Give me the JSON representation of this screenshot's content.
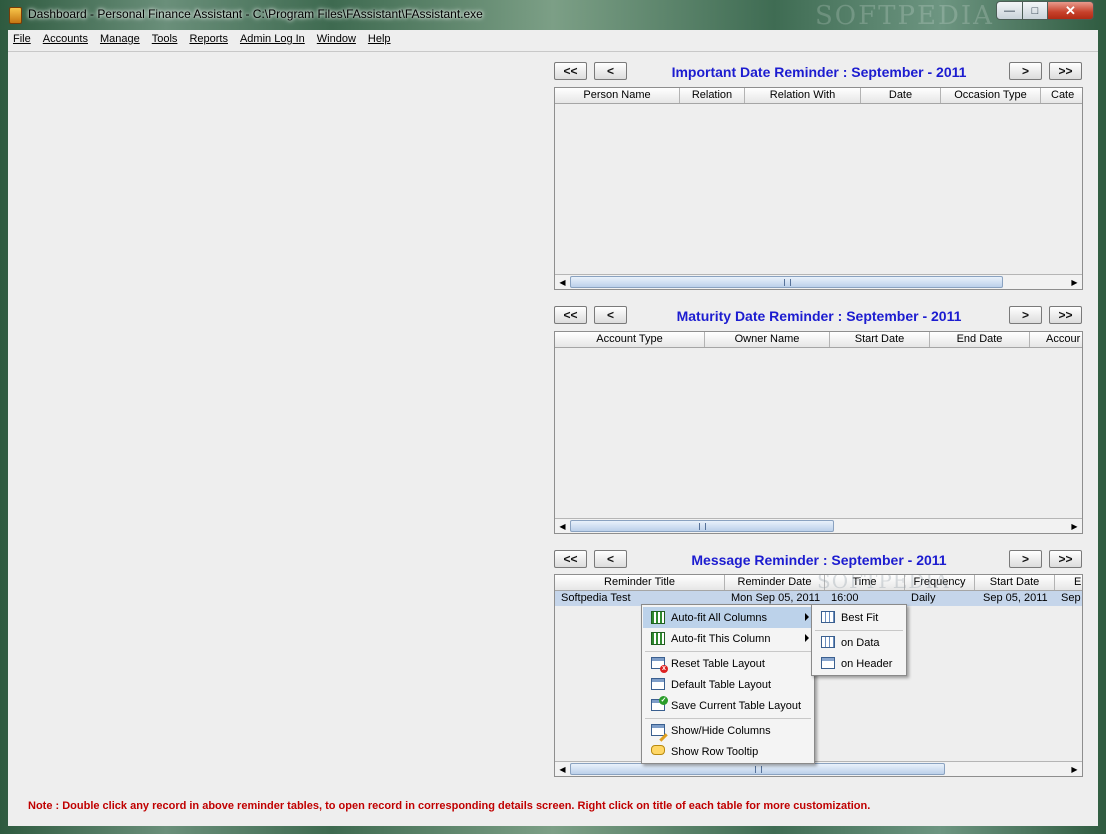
{
  "window": {
    "title": "Dashboard - Personal Finance Assistant - C:\\Program Files\\FAssistant\\FAssistant.exe",
    "watermark": "SOFTPEDIA",
    "min_glyph": "—",
    "max_glyph": "□",
    "close_glyph": "✕"
  },
  "menu": [
    "File",
    "Accounts",
    "Manage",
    "Tools",
    "Reports",
    "Admin Log In",
    "Window",
    "Help"
  ],
  "nav": {
    "first": "<<",
    "prev": "<",
    "next": ">",
    "last": ">>"
  },
  "important": {
    "title": "Important Date Reminder : September - 2011",
    "columns": [
      "Person Name",
      "Relation",
      "Relation With",
      "Date",
      "Occasion Type",
      "Cate"
    ]
  },
  "maturity": {
    "title": "Maturity Date Reminder : September - 2011",
    "columns": [
      "Account Type",
      "Owner Name",
      "Start Date",
      "End Date",
      "Accour"
    ]
  },
  "message": {
    "title": "Message Reminder : September - 2011",
    "columns": [
      "Reminder Title",
      "Reminder Date",
      "Time",
      "Frequency",
      "Start Date",
      "E"
    ],
    "rows": [
      [
        "Softpedia Test",
        "Mon Sep 05, 2011",
        "16:00",
        "Daily",
        "Sep 05, 2011",
        "Sep"
      ]
    ],
    "watermark": "SOFTPEDIA"
  },
  "context_menu": {
    "items": [
      {
        "label": "Auto-fit All Columns",
        "icon": "auto-fit-columns-icon",
        "submenu": true,
        "highlighted": true
      },
      {
        "label": "Auto-fit This Column",
        "icon": "auto-fit-column-icon",
        "submenu": true
      },
      {
        "label": "Reset Table Layout",
        "icon": "reset-table-icon"
      },
      {
        "label": "Default Table Layout",
        "icon": "default-table-icon"
      },
      {
        "label": "Save Current Table Layout",
        "icon": "save-table-icon"
      },
      {
        "label": "Show/Hide Columns",
        "icon": "show-hide-columns-icon"
      },
      {
        "label": "Show Row Tooltip",
        "icon": "tooltip-icon"
      }
    ]
  },
  "submenu": {
    "items": [
      {
        "label": "Best Fit",
        "icon": "best-fit-icon"
      },
      {
        "label": "on Data",
        "icon": "on-data-icon"
      },
      {
        "label": "on Header",
        "icon": "on-header-icon"
      }
    ]
  },
  "note": "Note : Double click any record in above reminder tables, to open record in corresponding details screen. Right click on title of each table for more customization.",
  "colors": {
    "title_blue": "#1c1cd0",
    "note_red": "#c00000",
    "selection": "#c5d5ea",
    "menu_highlight": "#bcd2ea"
  }
}
